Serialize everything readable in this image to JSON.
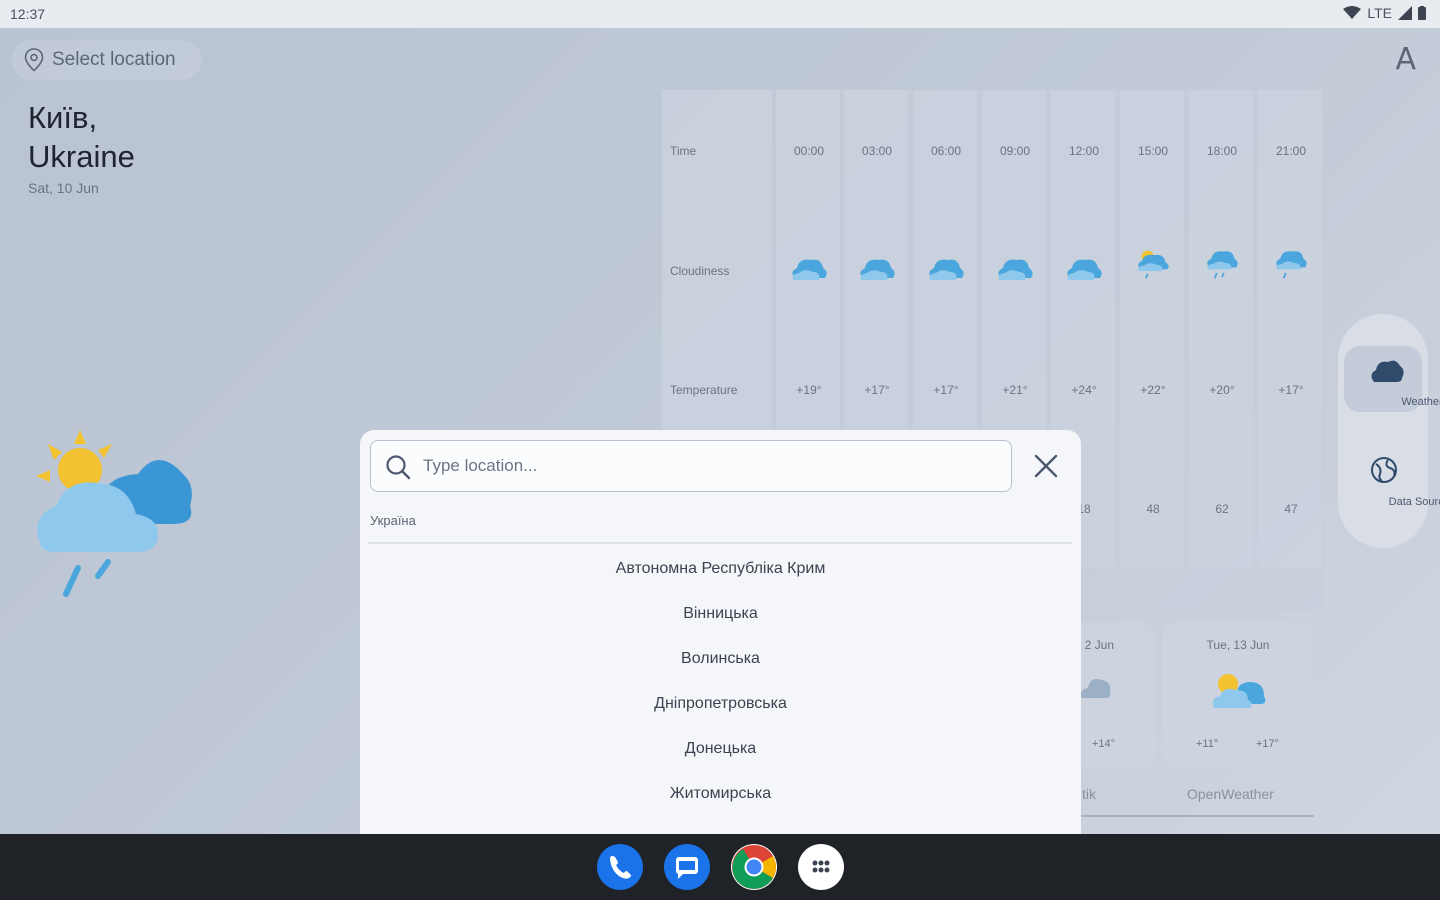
{
  "status_bar": {
    "time": "12:37",
    "network": "LTE"
  },
  "header": {
    "select_location": "Select location",
    "font_icon": "A"
  },
  "location": {
    "city_line1": "Київ,",
    "city_line2": "Ukraine",
    "date": "Sat, 10 Jun"
  },
  "forecast": {
    "labels": {
      "time": "Time",
      "cloudiness": "Cloudiness",
      "temperature": "Temperature"
    },
    "times": [
      "00:00",
      "03:00",
      "06:00",
      "09:00",
      "12:00",
      "15:00",
      "18:00",
      "21:00"
    ],
    "temps": [
      "+19°",
      "+17°",
      "+17°",
      "+21°",
      "+24°",
      "+22°",
      "+20°",
      "+17°"
    ],
    "row4_visible": [
      "18",
      "48",
      "62",
      "47"
    ]
  },
  "daily": {
    "card1": {
      "title_partial": "2 Jun",
      "tmax": "+14°"
    },
    "card2": {
      "title": "Tue, 13 Jun",
      "tmin": "+11°",
      "tmax": "+17°"
    },
    "source_partial": "tik",
    "source2": "OpenWeather"
  },
  "rail": {
    "weather": "Weather",
    "data_sources": "Data Sources"
  },
  "dialog": {
    "search_placeholder": "Type location...",
    "region": "Україна",
    "items": [
      "Автономна Республіка Крим",
      "Вінницька",
      "Волинська",
      "Дніпропетровська",
      "Донецька",
      "Житомирська"
    ]
  },
  "colors": {
    "accent": "#3a8fd0",
    "rail": "#d9dde6",
    "navbar": "#1f2227"
  }
}
